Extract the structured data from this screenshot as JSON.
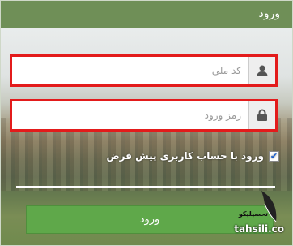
{
  "header": {
    "title": "ورود"
  },
  "form": {
    "username_placeholder": "کد ملی",
    "password_placeholder": "رمز ورود",
    "remember_label": "ورود با حساب کاربری پیش فرض",
    "remember_checked": true,
    "submit_label": "ورود"
  },
  "watermark": {
    "brand": "تحصیلیکو",
    "site": "tahsili.co"
  },
  "icons": {
    "user": "user-icon",
    "lock": "lock-icon"
  },
  "colors": {
    "header": "#6f8f57",
    "button": "#5fa84a",
    "highlight": "#e31b1b"
  }
}
